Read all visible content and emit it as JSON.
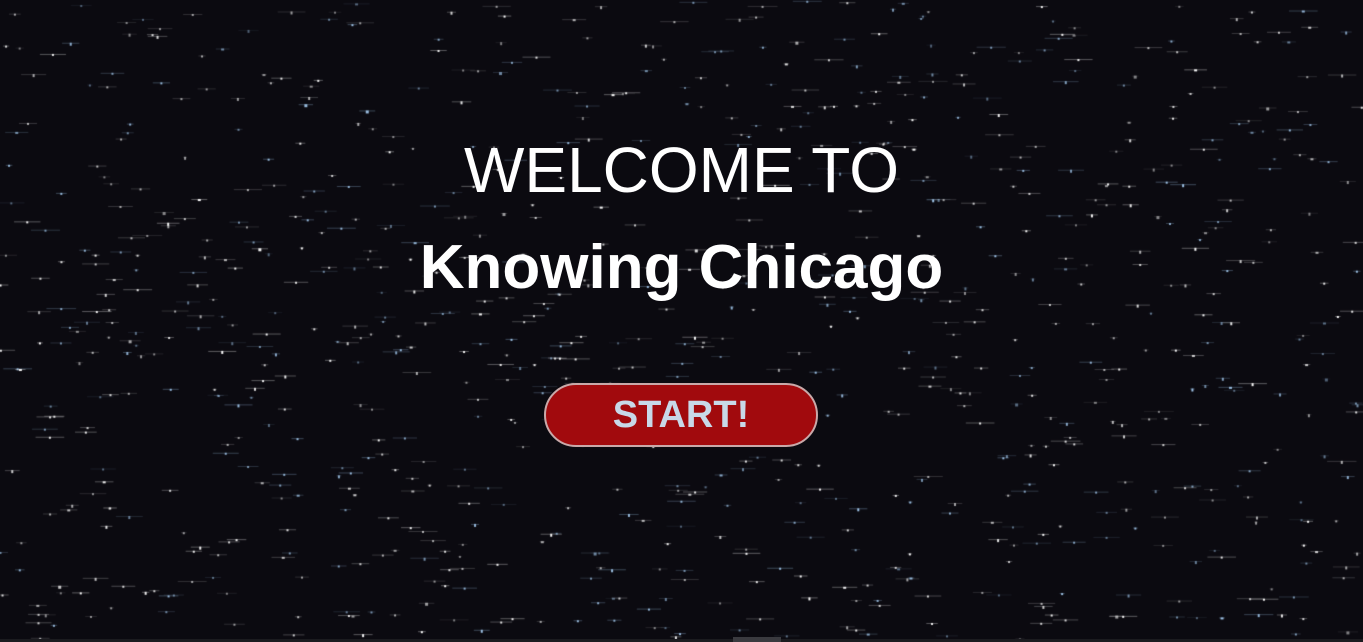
{
  "welcome": {
    "prefix": "WELCOME TO",
    "title": "Knowing Chicago"
  },
  "start_button": {
    "label": "START!"
  },
  "colors": {
    "background": "#0b0a10",
    "text": "#ffffff",
    "button_fill": "#a10a0d",
    "button_border": "#c9a9a9",
    "button_text": "#c8d8e8",
    "star": "#ffffff",
    "star_tint": "#9fc4e8"
  }
}
